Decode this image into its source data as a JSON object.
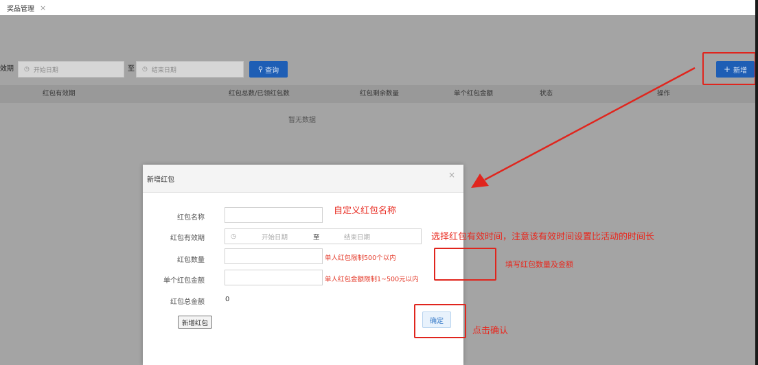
{
  "tabs": [
    {
      "label": "奖品管理",
      "close": "×"
    }
  ],
  "filters": {
    "label": "效期",
    "start_placeholder": "开始日期",
    "to": "至",
    "end_placeholder": "结束日期",
    "query_icon": "search-icon",
    "query_label": "查询",
    "add_icon": "plus-icon",
    "add_label": "新增"
  },
  "table": {
    "columns": [
      "红包有效期",
      "红包总数/已领红包数",
      "红包剩余数量",
      "单个红包金额",
      "状态",
      "操作"
    ],
    "empty_text": "暂无数据"
  },
  "modal": {
    "title": "新增红包",
    "close": "×",
    "fields": {
      "name_label": "红包名称",
      "validity_label": "红包有效期",
      "start_placeholder": "开始日期",
      "to": "至",
      "end_placeholder": "结束日期",
      "count_label": "红包数量",
      "count_hint": "单人红包限制500个以内",
      "amount_label": "单个红包金额",
      "amount_hint": "单人红包金额限制1~500元以内",
      "total_label": "红包总金额",
      "total_value": "0"
    },
    "add_btn": "新增红包",
    "ok_btn": "确定"
  },
  "annotations": {
    "name": "自定义红包名称",
    "validity": "选择红包有效时间，注意该有效时间设置比活动的时间长",
    "count": "填写红包数量及金额",
    "confirm": "点击确认"
  },
  "colors": {
    "primary": "#1e5eb5",
    "annotation": "#e0251d",
    "overlay": "#a4a4a4"
  }
}
